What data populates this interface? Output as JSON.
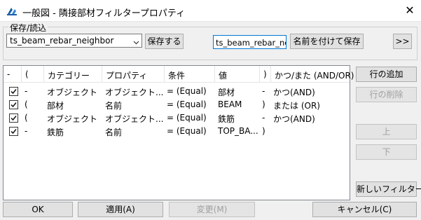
{
  "window": {
    "title": "一般図 - 隣接部材フィルタープロパティ",
    "close_glyph": "✕"
  },
  "save_load": {
    "group_label": "保存/読込",
    "combo_value": "ts_beam_rebar_neighbor",
    "save_button": "保存する",
    "name_input_value": "ts_beam_rebar_neig",
    "save_as_button": "名前を付けて保存",
    "more_button": ">>"
  },
  "table": {
    "columns": [
      "-",
      "(",
      "カテゴリー",
      "プロパティ",
      "条件",
      "値",
      ")",
      "かつ/また (AND/OR)"
    ],
    "rows": [
      {
        "checked": true,
        "dash": "-",
        "open": "",
        "category": "オブジェクト",
        "property": "オブジェクト...",
        "condition": "= (Equal)",
        "value": "部材",
        "close": "-",
        "andor": "かつ(AND)"
      },
      {
        "checked": true,
        "dash": "(",
        "open": "",
        "category": "部材",
        "property": "名前",
        "condition": "= (Equal)",
        "value": "BEAM",
        "close": ")",
        "andor": "または (OR)"
      },
      {
        "checked": true,
        "dash": "(",
        "open": "",
        "category": "オブジェクト",
        "property": "オブジェクト...",
        "condition": "= (Equal)",
        "value": "鉄筋",
        "close": "-",
        "andor": "かつ(AND)"
      },
      {
        "checked": true,
        "dash": "-",
        "open": "",
        "category": "鉄筋",
        "property": "名前",
        "condition": "= (Equal)",
        "value": "TOP_BA...",
        "close": ")",
        "andor": ""
      }
    ]
  },
  "side_buttons": {
    "add_row": "行の追加",
    "delete_row": "行の削除",
    "up": "上",
    "down": "下",
    "new_filter": "新しいフィルター"
  },
  "bottom_buttons": {
    "ok": "OK",
    "apply": "適用(A)",
    "modify": "変更(M)",
    "cancel": "キャンセル(C)"
  }
}
